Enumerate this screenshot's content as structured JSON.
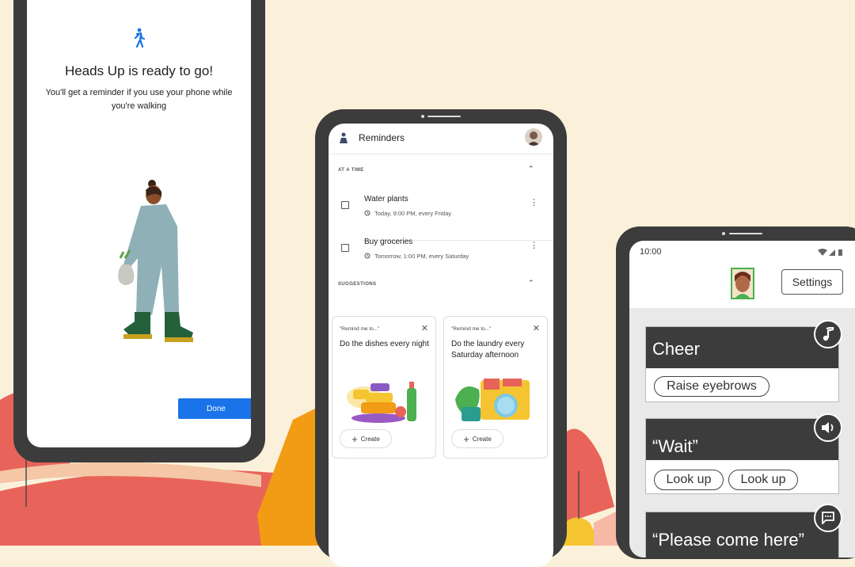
{
  "phone1": {
    "title": "Heads Up is ready to go!",
    "subtitle": "You'll get a reminder if you use your phone while you're walking",
    "done_label": "Done"
  },
  "phone2": {
    "app_name": "Reminders",
    "section_time": "AT A TIME",
    "section_suggestions": "SUGGESTIONS",
    "reminders": [
      {
        "title": "Water plants",
        "schedule": "Today, 9:00 PM, every Friday"
      },
      {
        "title": "Buy groceries",
        "schedule": "Tomorrow, 1:00 PM, every Saturday"
      }
    ],
    "suggestions": [
      {
        "prompt": "\"Remind me to...\"",
        "text": "Do the dishes every night",
        "create_label": "Create"
      },
      {
        "prompt": "\"Remind me to...\"",
        "text": "Do the laundry every Saturday afternoon",
        "create_label": "Create"
      }
    ]
  },
  "phone3": {
    "time": "10:00",
    "settings_label": "Settings",
    "gestures": [
      {
        "phrase": "Cheer",
        "chips": [
          "Raise eyebrows"
        ],
        "icon": "music-note-icon"
      },
      {
        "phrase": "“Wait”",
        "chips": [
          "Look up",
          "Look up"
        ],
        "icon": "speaker-icon"
      },
      {
        "phrase": "“Please come here”",
        "chips": [],
        "icon": "chat-icon"
      }
    ]
  },
  "colors": {
    "background": "#fbf1da",
    "coral": "#e8645a",
    "orange": "#f29b14",
    "blue_button": "#1a73e8",
    "phone_frame": "#3c3c3c"
  }
}
